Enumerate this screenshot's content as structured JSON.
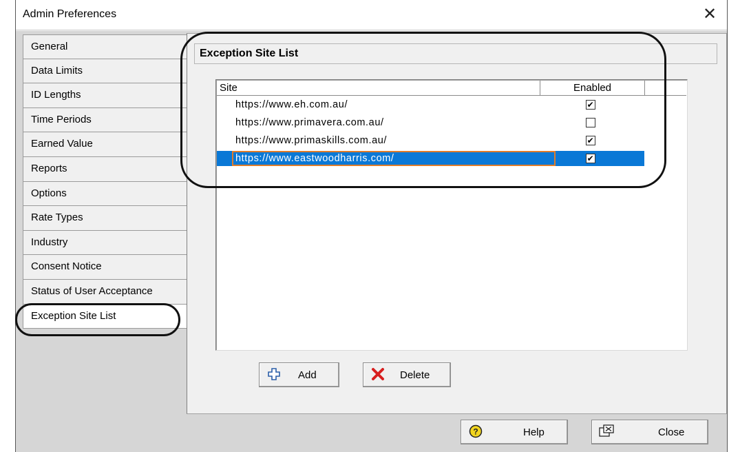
{
  "window": {
    "title": "Admin Preferences",
    "close_glyph": "✕"
  },
  "tabs": [
    {
      "label": "General"
    },
    {
      "label": "Data Limits"
    },
    {
      "label": "ID Lengths"
    },
    {
      "label": "Time Periods"
    },
    {
      "label": "Earned Value"
    },
    {
      "label": "Reports"
    },
    {
      "label": "Options"
    },
    {
      "label": "Rate Types"
    },
    {
      "label": "Industry"
    },
    {
      "label": "Consent Notice"
    },
    {
      "label": "Status of User Acceptance"
    },
    {
      "label": "Exception Site List"
    }
  ],
  "active_tab": "Exception Site List",
  "panel": {
    "title": "Exception Site List",
    "columns": {
      "site": "Site",
      "enabled": "Enabled"
    },
    "rows": [
      {
        "site": "https://www.eh.com.au/",
        "enabled": true
      },
      {
        "site": "https://www.primavera.com.au/",
        "enabled": false
      },
      {
        "site": "https://www.primaskills.com.au/",
        "enabled": true
      },
      {
        "site": "https://www.eastwoodharris.com/",
        "enabled": true,
        "selected": true
      }
    ],
    "add_label": "Add",
    "delete_label": "Delete"
  },
  "footer": {
    "help_label": "Help",
    "close_label": "Close"
  },
  "icons": {
    "add": "plus-outline-icon",
    "delete": "red-x-icon",
    "help": "question-circle-icon",
    "close": "close-window-icon",
    "checkmark": "✔"
  },
  "colors": {
    "selection": "#0a78d6",
    "focus_border": "#e07d2a",
    "delete_icon": "#d81f1f",
    "help_icon": "#f2d51f"
  }
}
